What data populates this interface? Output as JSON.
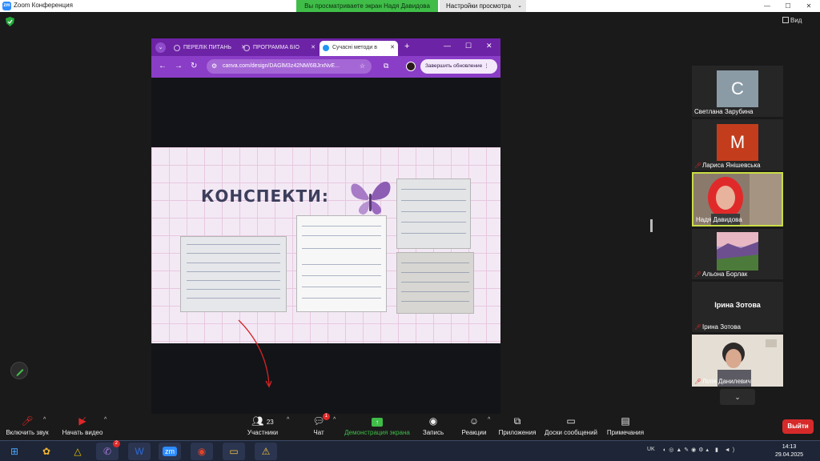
{
  "window": {
    "title": "Zoom Конференция",
    "min": "—",
    "max": "☐",
    "close": "✕"
  },
  "share_banner": "Вы просматриваете экран Надя Давидова",
  "view_settings": "Настройки просмотра",
  "view_button": "Вид",
  "browser": {
    "tabs": [
      {
        "label": "ПЕРЕЛІК ПИТАНЬ"
      },
      {
        "label": "ПРОГРАММА БІО"
      },
      {
        "label": "Сучасні методи в"
      }
    ],
    "url": "canva.com/design/DAGlM3z42NM/6BJrxNvE...",
    "update_button": "Завершить обновление"
  },
  "slide": {
    "title": "КОНСПЕКТИ:"
  },
  "participants": [
    {
      "name": "Светлана Зарубина",
      "initial": "С",
      "color": "#8a9ba6",
      "muted": false
    },
    {
      "name": "Лариса Янішевська",
      "initial": "М",
      "color": "#c33d1c",
      "muted": true
    },
    {
      "name": "Надя Давидова",
      "muted": false,
      "active_speaker": true
    },
    {
      "name": "Альона Борлак",
      "muted": true
    },
    {
      "name": "Ірина Зотова",
      "center_name": "Ірина Зотова",
      "muted": true
    },
    {
      "name": "Лілія Данилевич",
      "muted": true
    }
  ],
  "toolbar": {
    "audio": "Включить звук",
    "video": "Начать видео",
    "participants": "Участники",
    "participants_count": "23",
    "chat": "Чат",
    "chat_badge": "1",
    "share": "Демонстрация экрана",
    "record": "Запись",
    "reactions": "Реакции",
    "apps": "Приложения",
    "whiteboards": "Доски сообщений",
    "notes": "Примечания",
    "leave": "Выйти"
  },
  "taskbar": {
    "lang": "UK",
    "time": "14:13",
    "date": "29.04.2025",
    "viber_badge": "2"
  },
  "icons": [
    "shield-icon",
    "pen-icon",
    "butterfly-icon",
    "chevron-down-icon"
  ]
}
